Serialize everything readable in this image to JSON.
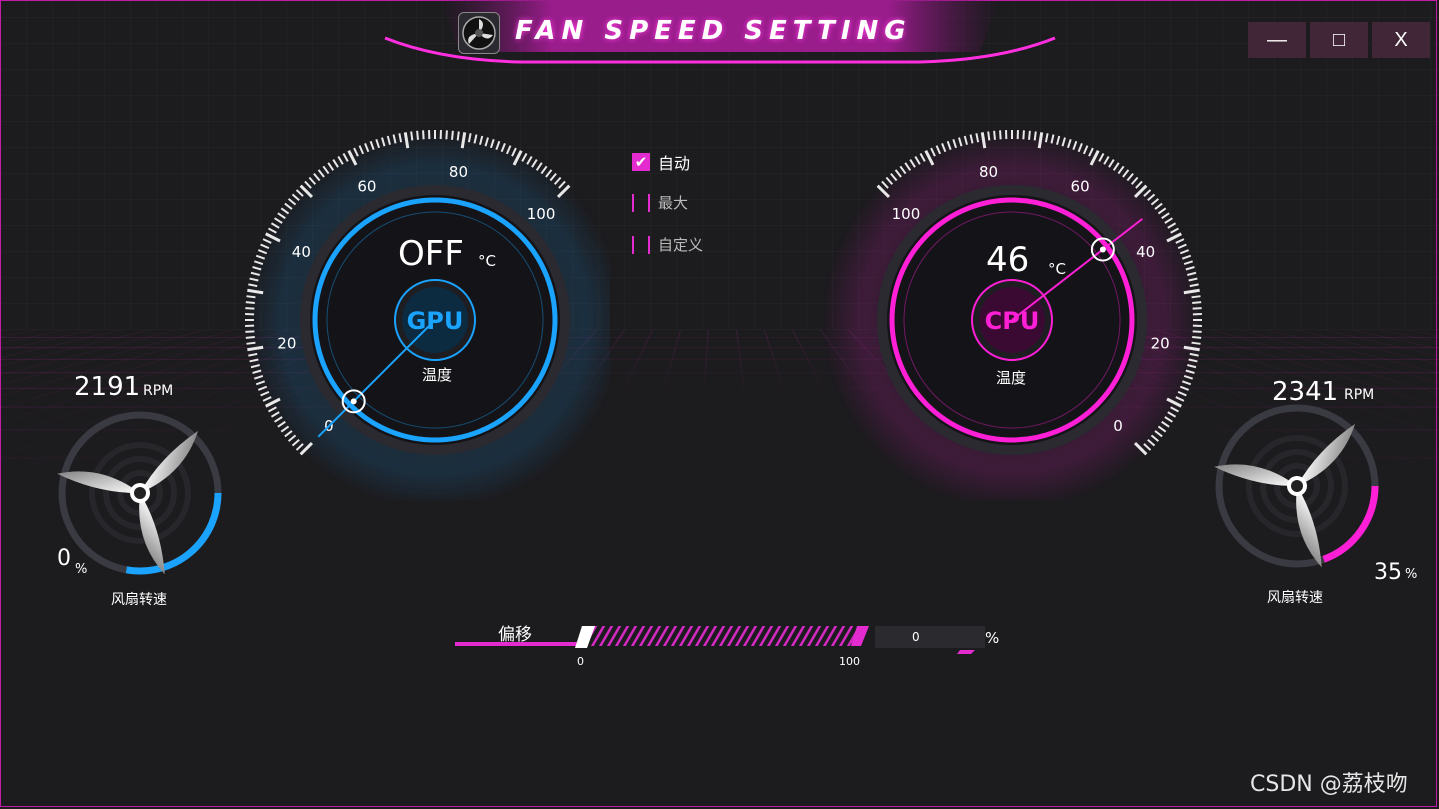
{
  "window": {
    "title": "FAN SPEED SETTING",
    "minimize_label": "—",
    "maximize_label": "□",
    "close_label": "X"
  },
  "modes": [
    {
      "label": "自动",
      "checked": true
    },
    {
      "label": "最大",
      "checked": false
    },
    {
      "label": "自定义",
      "checked": false
    }
  ],
  "gpu": {
    "name": "GPU",
    "temp_value": "OFF",
    "temp_unit": "°C",
    "temp_label": "温度",
    "ticks": [
      "0",
      "20",
      "40",
      "60",
      "80",
      "100"
    ],
    "needle_value": 0,
    "color": "#1aa3ff",
    "fan_rpm": "2191",
    "rpm_unit": "RPM",
    "fan_percent": "0",
    "percent_unit": "%",
    "fan_label": "风扇转速"
  },
  "cpu": {
    "name": "CPU",
    "temp_value": "46",
    "temp_unit": "°C",
    "temp_label": "温度",
    "ticks": [
      "0",
      "20",
      "40",
      "60",
      "80",
      "100"
    ],
    "needle_value": 46,
    "color": "#ff1fd6",
    "fan_rpm": "2341",
    "rpm_unit": "RPM",
    "fan_percent": "35",
    "percent_unit": "%",
    "fan_label": "风扇转速"
  },
  "offset": {
    "label": "偏移",
    "min_label": "0",
    "max_label": "100",
    "value": "0",
    "unit": "%"
  },
  "watermark": "CSDN @荔枝吻"
}
